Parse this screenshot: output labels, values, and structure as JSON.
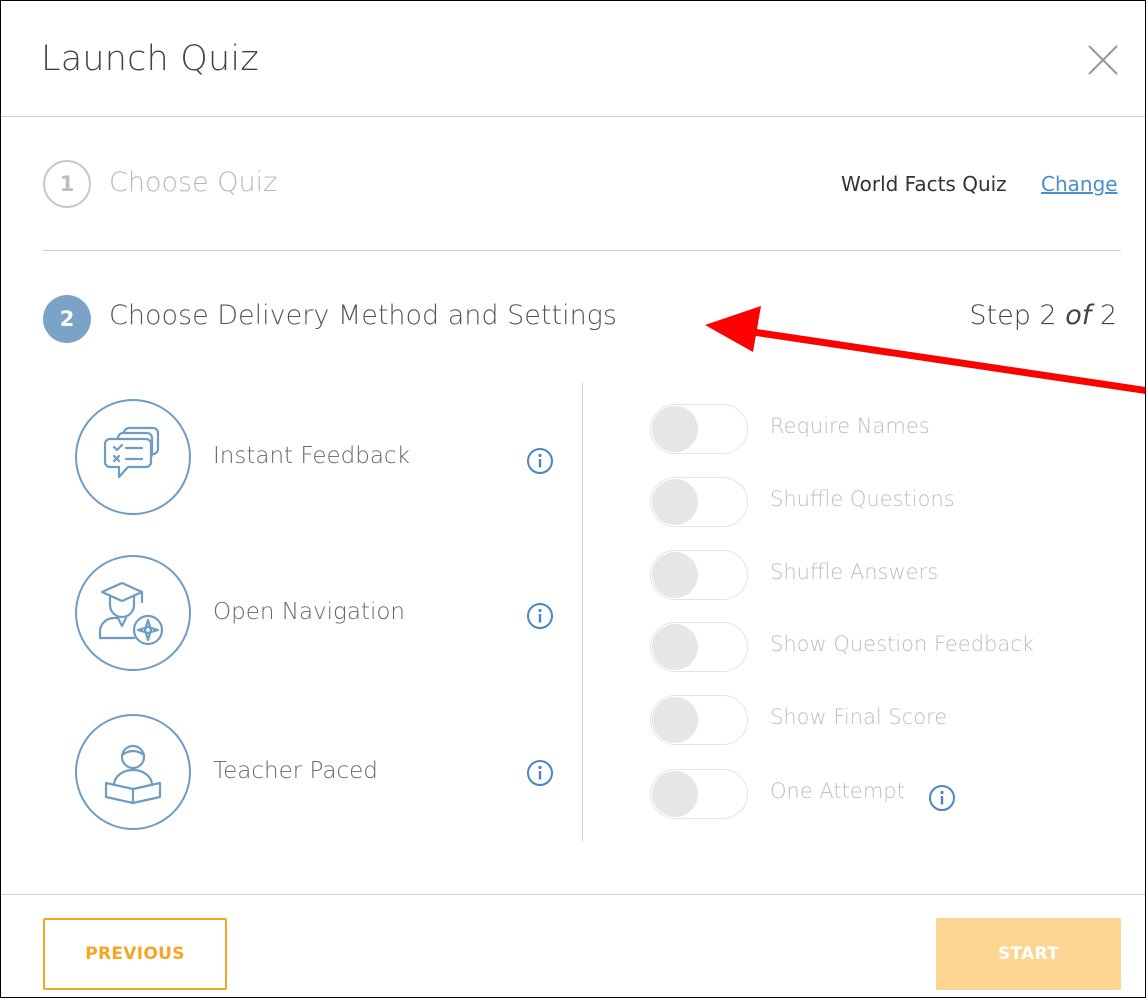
{
  "modal": {
    "title": "Launch Quiz"
  },
  "step1": {
    "number": "1",
    "label": "Choose Quiz",
    "quiz_name": "World Facts Quiz",
    "change_label": "Change"
  },
  "step2": {
    "number": "2",
    "label": "Choose Delivery Method and Settings",
    "step_prefix": "Step 2 ",
    "step_of": "of",
    "step_total": " 2"
  },
  "methods": [
    {
      "label": "Instant Feedback",
      "icon": "chat-cards-icon"
    },
    {
      "label": "Open Navigation",
      "icon": "student-compass-icon"
    },
    {
      "label": "Teacher Paced",
      "icon": "teacher-reading-icon"
    }
  ],
  "settings": [
    {
      "label": "Require Names",
      "on": false
    },
    {
      "label": "Shuffle Questions",
      "on": false
    },
    {
      "label": "Shuffle Answers",
      "on": false
    },
    {
      "label": "Show Question Feedback",
      "on": false
    },
    {
      "label": "Show Final Score",
      "on": false
    },
    {
      "label": "One Attempt",
      "on": false
    }
  ],
  "footer": {
    "previous_label": "PREVIOUS",
    "start_label": "START"
  },
  "colors": {
    "accent_blue": "#6e9cc4",
    "accent_orange": "#f5a623",
    "start_disabled": "#fdd592",
    "annotation_arrow": "#ff0000"
  }
}
